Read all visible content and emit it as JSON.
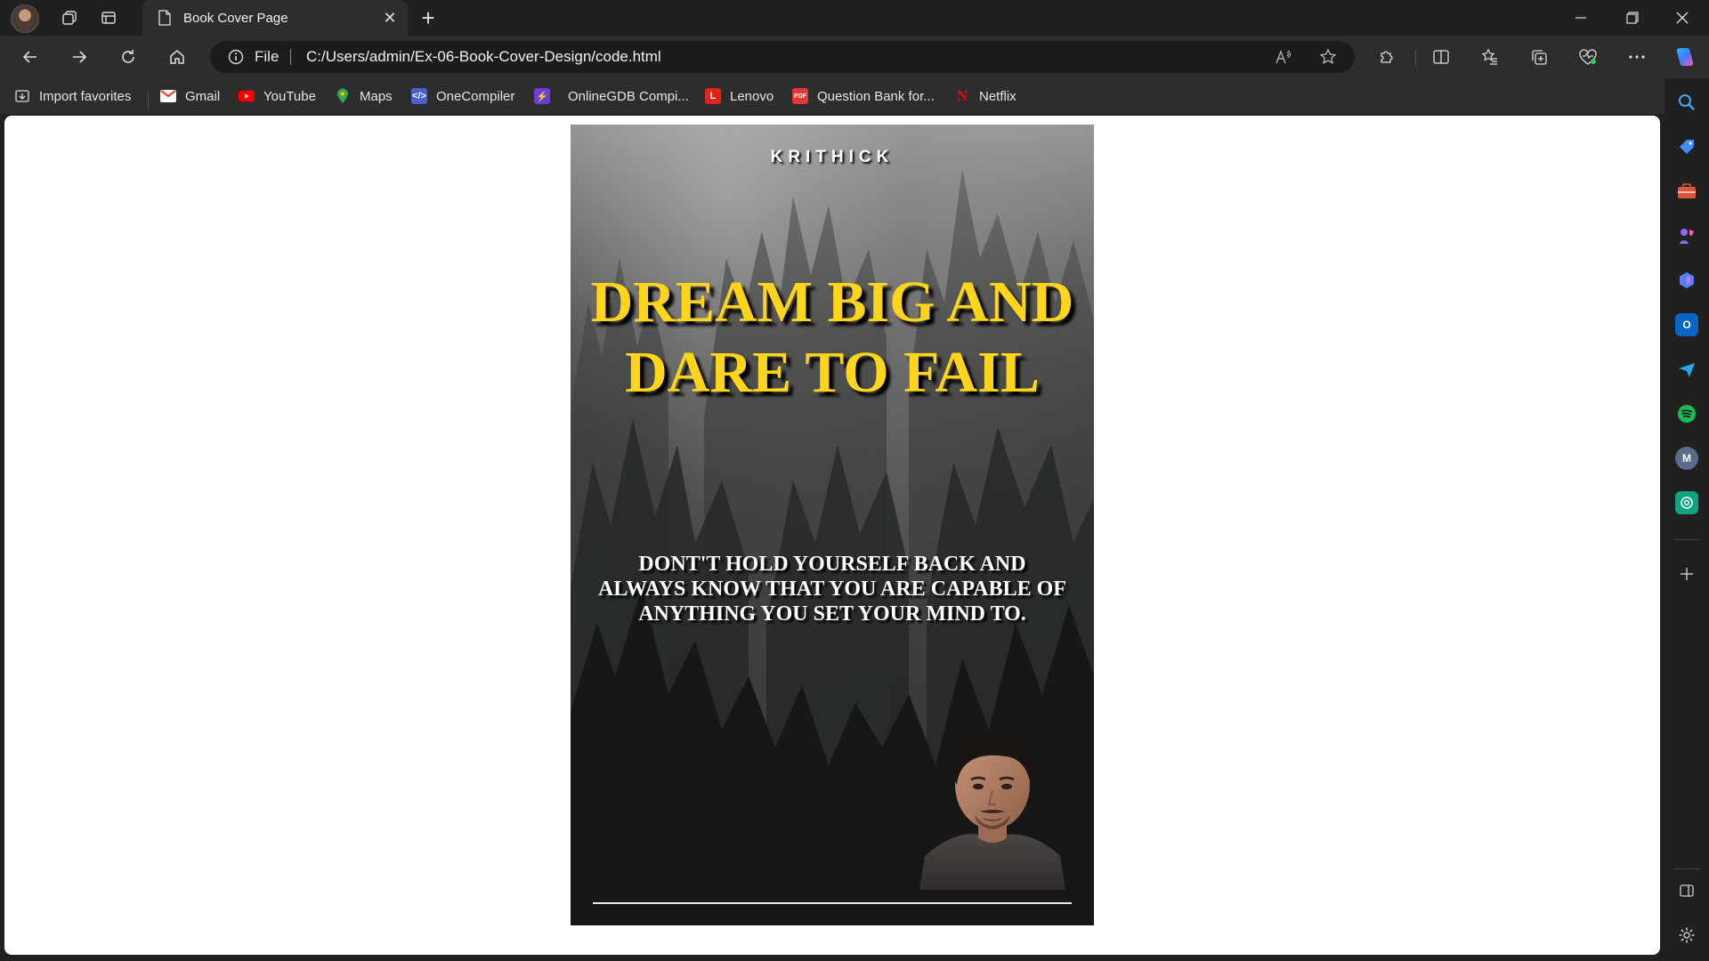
{
  "browser": {
    "tab": {
      "title": "Book Cover Page"
    },
    "address": {
      "scheme_label": "File",
      "url": "C:/Users/admin/Ex-06-Book-Cover-Design/code.html"
    },
    "favorites": [
      {
        "label": "Import favorites",
        "icon": "import-icon"
      },
      {
        "label": "Gmail",
        "icon": "gmail-icon",
        "color": "#ea4335"
      },
      {
        "label": "YouTube",
        "icon": "youtube-icon",
        "color": "#ff0000"
      },
      {
        "label": "Maps",
        "icon": "maps-pin-icon",
        "color": "#34a853"
      },
      {
        "label": "OneCompiler",
        "icon": "onecompiler-icon",
        "color": "#4a5fd1"
      },
      {
        "label": "OnlineGDB Compi...",
        "icon": "onlinegdb-icon",
        "color": "#6b3fd4"
      },
      {
        "label": "Lenovo",
        "icon": "lenovo-icon",
        "color": "#e2231a",
        "glyph": "L"
      },
      {
        "label": "Question Bank for...",
        "icon": "pdf-icon",
        "color": "#e53935",
        "glyph": "PDF"
      },
      {
        "label": "Netflix",
        "icon": "netflix-icon",
        "color": "#e50914",
        "glyph": "N"
      }
    ],
    "sidebar": {
      "outlook_glyph": "O",
      "m_glyph": "M"
    }
  },
  "cover": {
    "author": "KRITHICK",
    "title": "DREAM BIG AND DARE TO FAIL",
    "tagline": "DONT'T HOLD YOURSELF BACK AND ALWAYS KNOW THAT YOU ARE CAPABLE OF ANYTHING YOU SET YOUR MIND TO.",
    "title_color": "#ffd51a"
  }
}
